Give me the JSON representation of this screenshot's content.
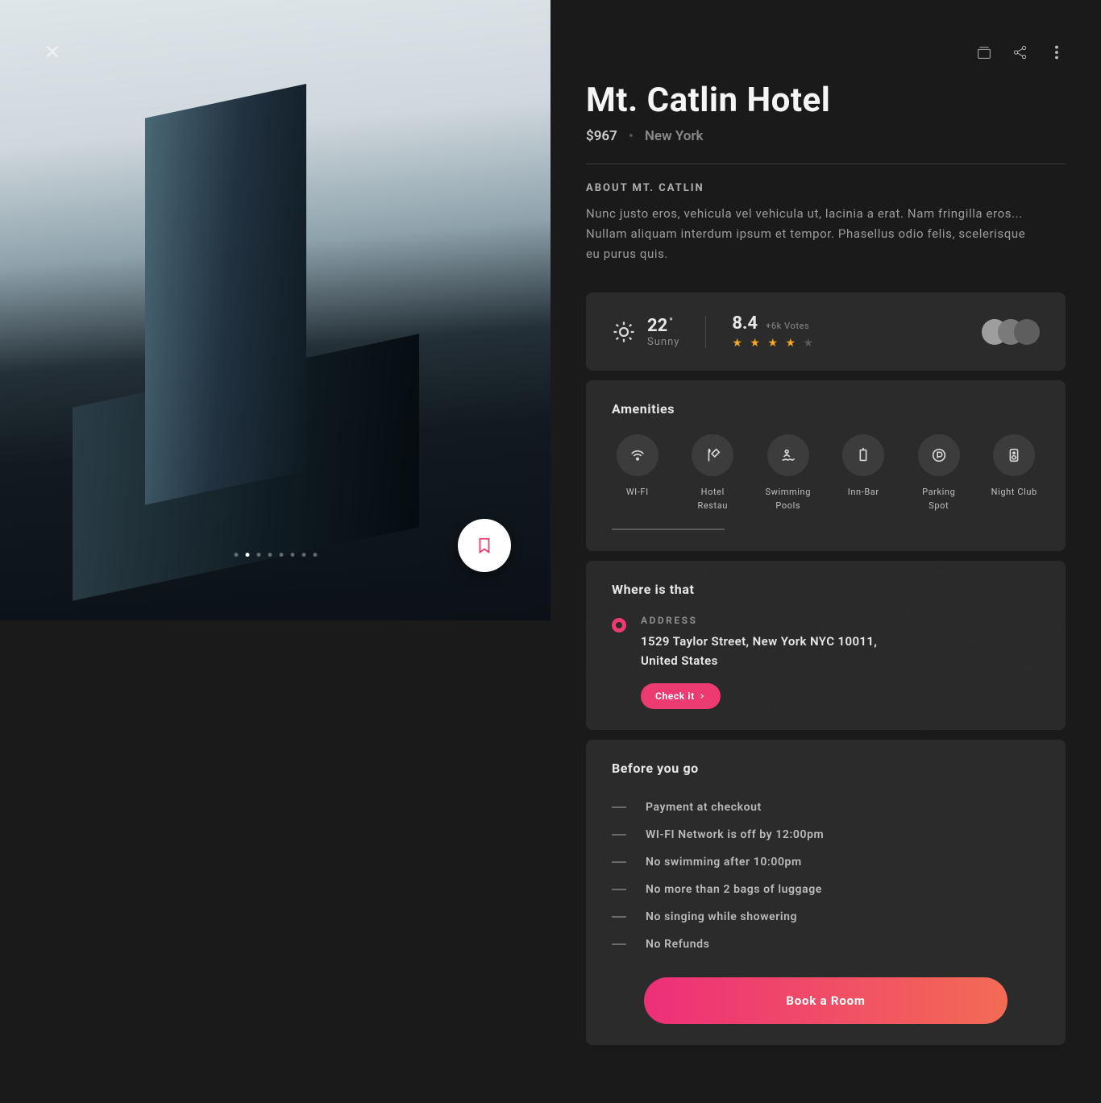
{
  "hotel": {
    "name": "Mt. Catlin Hotel",
    "price": "$967",
    "city": "New York"
  },
  "about": {
    "heading": "ABOUT MT. CATLIN",
    "body": "Nunc justo eros, vehicula vel vehicula ut, lacinia a erat. Nam fringilla eros... Nullam aliquam interdum ipsum et tempor. Phasellus odio felis, scelerisque eu purus quis."
  },
  "weather": {
    "temp": "22",
    "degree": "°",
    "condition": "Sunny"
  },
  "rating": {
    "score": "8.4",
    "votes": "+6k Votes",
    "stars_filled": 4,
    "stars_total": 5
  },
  "amenities": {
    "heading": "Amenities",
    "items": [
      {
        "label": "WI-FI",
        "icon": "wifi"
      },
      {
        "label": "Hotel Restau",
        "icon": "restaurant"
      },
      {
        "label": "Swimming Pools",
        "icon": "pool"
      },
      {
        "label": "Inn-Bar",
        "icon": "bar"
      },
      {
        "label": "Parking Spot",
        "icon": "parking"
      },
      {
        "label": "Night Club",
        "icon": "club"
      }
    ]
  },
  "where": {
    "heading": "Where is that",
    "address_label": "ADDRESS",
    "address": "1529 Taylor Street, New York NYC 10011, United States",
    "button": "Check it"
  },
  "before": {
    "heading": "Before you go",
    "rules": [
      "Payment at checkout",
      "WI-FI Network is off by 12:00pm",
      "No swimming after 10:00pm",
      "No more than 2 bags of luggage",
      "No singing while showering",
      "No Refunds"
    ]
  },
  "cta": {
    "book": "Book a Room"
  },
  "pager": {
    "total": 8,
    "active_index": 1
  }
}
